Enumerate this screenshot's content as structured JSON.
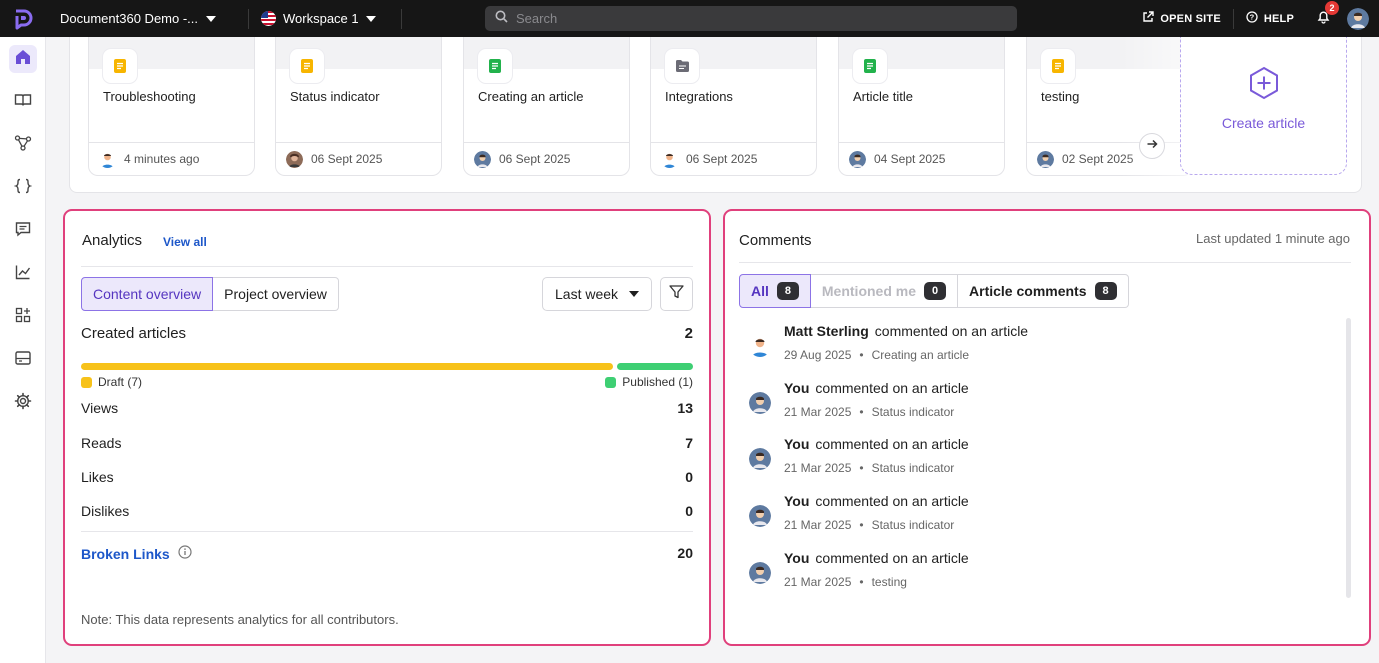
{
  "topbar": {
    "project_name": "Document360 Demo -...",
    "workspace_name": "Workspace 1",
    "search_placeholder": "Search",
    "open_site_label": "OPEN SITE",
    "help_label": "HELP",
    "notification_count": "2"
  },
  "colors": {
    "accent": "#7a5ad9",
    "highlight_border": "#e0407c",
    "draft": "#f7c21a",
    "published": "#3ecf73",
    "link": "#1d57c9"
  },
  "rail": {
    "items": [
      "home-icon",
      "book-icon",
      "tree-icon",
      "code-braces-icon",
      "chat-icon",
      "chart-icon",
      "widgets-icon",
      "layout-icon",
      "gear-icon"
    ]
  },
  "recent_articles": [
    {
      "title": "Troubleshooting",
      "date": "4 minutes ago",
      "doc_color": "#f7b500"
    },
    {
      "title": "Status indicator",
      "date": "06 Sept 2025",
      "doc_color": "#f7b500"
    },
    {
      "title": "Creating an article",
      "date": "06 Sept 2025",
      "doc_color": "#22b24c"
    },
    {
      "title": "Integrations",
      "date": "06 Sept 2025",
      "doc_color": "#6b6b75"
    },
    {
      "title": "Article title",
      "date": "04 Sept 2025",
      "doc_color": "#22b24c"
    },
    {
      "title": "testing",
      "date": "02 Sept 2025",
      "doc_color": "#f7b500"
    }
  ],
  "create_article_label": "Create article",
  "analytics": {
    "title": "Analytics",
    "view_all": "View all",
    "tabs": [
      "Content overview",
      "Project overview"
    ],
    "period": "Last week",
    "created_label": "Created articles",
    "created_value": "2",
    "draft_label": "Draft (7)",
    "published_label": "Published (1)",
    "draft_count": 7,
    "published_count": 1,
    "metrics": [
      {
        "label": "Views",
        "value": "13"
      },
      {
        "label": "Reads",
        "value": "7"
      },
      {
        "label": "Likes",
        "value": "0"
      },
      {
        "label": "Dislikes",
        "value": "0"
      }
    ],
    "broken_links_label": "Broken Links",
    "broken_links_value": "20",
    "note": "Note: This data represents analytics for all contributors."
  },
  "comments": {
    "title": "Comments",
    "last_updated": "Last updated 1 minute ago",
    "tabs": [
      {
        "label": "All",
        "count": "8"
      },
      {
        "label": "Mentioned me",
        "count": "0"
      },
      {
        "label": "Article comments",
        "count": "8"
      }
    ],
    "items": [
      {
        "author": "Matt Sterling",
        "action": "commented on an article",
        "date": "29 Aug 2025",
        "article": "Creating an article"
      },
      {
        "author": "You",
        "action": "commented on an article",
        "date": "21 Mar 2025",
        "article": "Status indicator"
      },
      {
        "author": "You",
        "action": "commented on an article",
        "date": "21 Mar 2025",
        "article": "Status indicator"
      },
      {
        "author": "You",
        "action": "commented on an article",
        "date": "21 Mar 2025",
        "article": "Status indicator"
      },
      {
        "author": "You",
        "action": "commented on an article",
        "date": "21 Mar 2025",
        "article": "testing"
      }
    ]
  }
}
